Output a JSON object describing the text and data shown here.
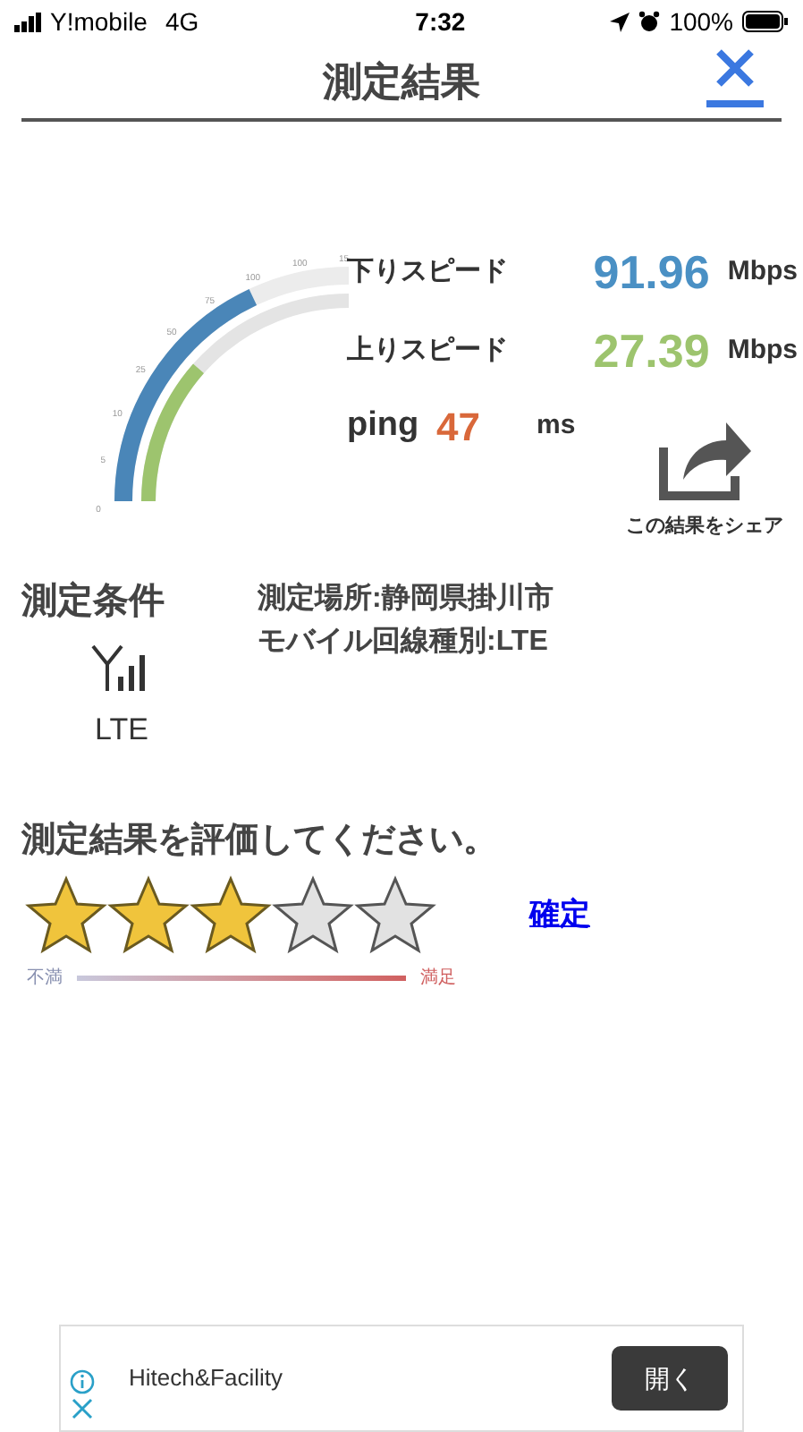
{
  "status_bar": {
    "carrier": "Y!mobile",
    "network": "4G",
    "time": "7:32",
    "battery": "100%"
  },
  "header": {
    "title": "測定結果"
  },
  "gauge": {
    "ticks": [
      "0",
      "5",
      "10",
      "25",
      "50",
      "75",
      "100",
      "100",
      "15"
    ]
  },
  "results": [
    {
      "kind": "speed",
      "label": "下りスピード",
      "value": "91.96",
      "unit": "Mbps",
      "color": "#4a90c4"
    },
    {
      "kind": "speed",
      "label": "上りスピード",
      "value": "27.39",
      "unit": "Mbps",
      "color": "#9dc46e"
    },
    {
      "kind": "ping",
      "label": "ping",
      "value": "47",
      "unit": "ms",
      "color": "#d9683a"
    }
  ],
  "share": {
    "label": "この結果をシェア"
  },
  "conditions": {
    "title": "測定条件",
    "network": "LTE",
    "lines": [
      "測定場所:静岡県掛川市",
      "モバイル回線種別:LTE"
    ]
  },
  "rating": {
    "title": "測定結果を評価してください。",
    "stars": 3,
    "confirm": "確定",
    "low_label": "不満",
    "high_label": "満足"
  },
  "ad": {
    "name": "Hitech&Facility",
    "button": "開く"
  }
}
